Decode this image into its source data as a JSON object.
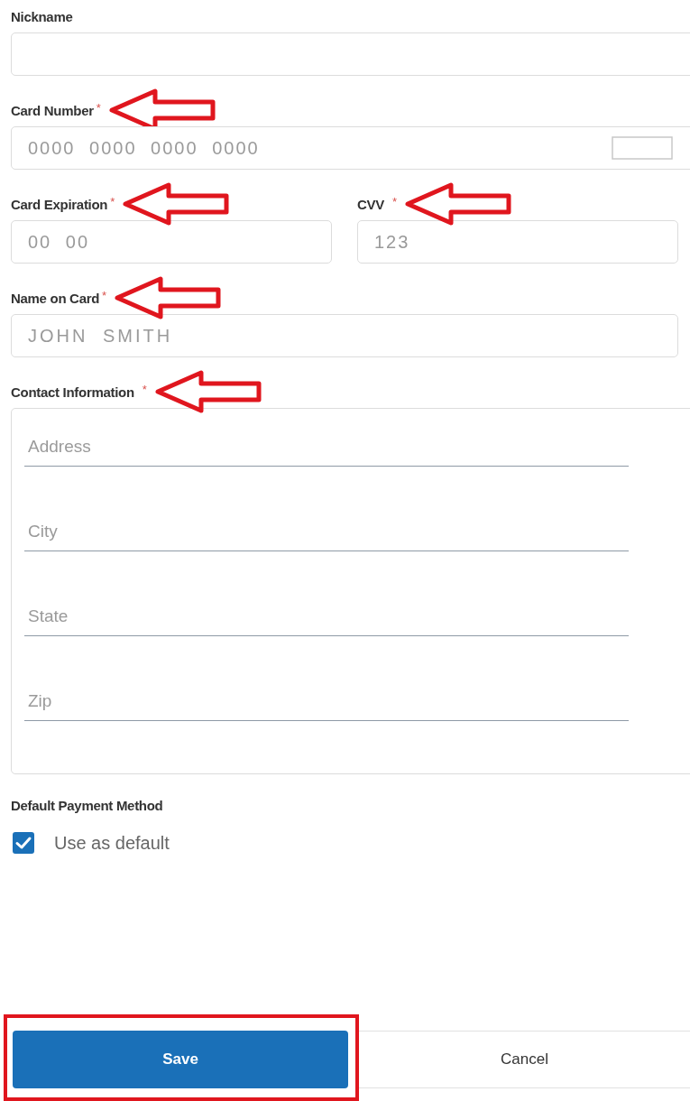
{
  "nickname": {
    "label": "Nickname"
  },
  "card_number": {
    "label": "Card Number",
    "required_mark": "*",
    "arrow": true,
    "placeholder": "0000 0000 0000 0000"
  },
  "expiration": {
    "label": "Card Expiration",
    "required_mark": "*",
    "arrow": true,
    "placeholder": "00 00"
  },
  "cvv": {
    "label": "CVV",
    "required_mark": "*",
    "arrow": true,
    "placeholder": "123"
  },
  "name_on_card": {
    "label": "Name on Card",
    "required_mark": "*",
    "arrow": true,
    "placeholder": "JOHN SMITH"
  },
  "contact": {
    "label": "Contact Information",
    "required_mark": "*",
    "arrow": true,
    "fields": [
      {
        "placeholder": "Address"
      },
      {
        "placeholder": "City"
      },
      {
        "placeholder": "State"
      },
      {
        "placeholder": "Zip"
      }
    ]
  },
  "default_payment": {
    "label": "Default Payment Method",
    "option": {
      "label": "Use as default",
      "checked": true
    }
  },
  "buttons": [
    {
      "label": "Save",
      "kind": "primary",
      "highlighted": true
    },
    {
      "label": "Cancel",
      "kind": "secondary",
      "highlighted": false
    }
  ]
}
